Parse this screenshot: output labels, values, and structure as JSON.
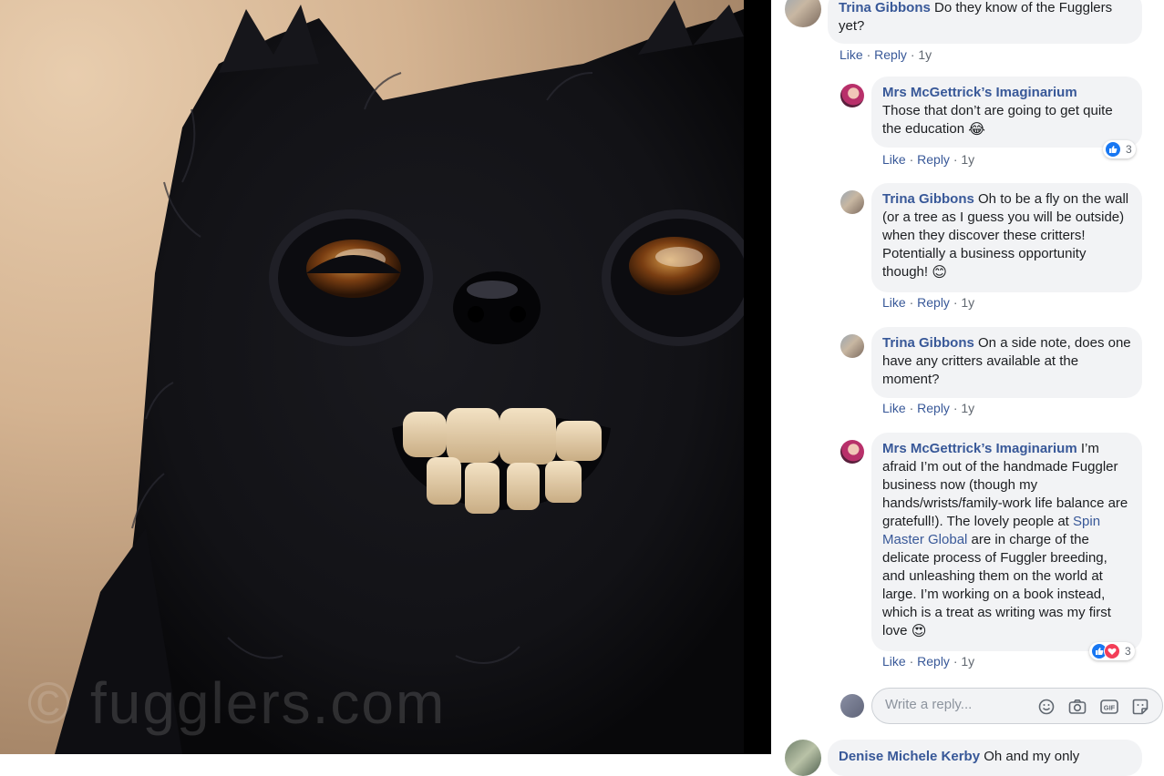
{
  "photo": {
    "watermark_text": "© fugglers.com",
    "description_icon": "fuggler-photo"
  },
  "comments": [
    {
      "author": "Trina Gibbons",
      "text": "Do they know of the Fugglers yet?",
      "actions": {
        "like": "Like",
        "reply": "Reply",
        "time": "1y"
      }
    },
    {
      "author": "Mrs McGettrick’s Imaginarium",
      "text": "Those that don’t are going to get quite the education",
      "emoji": "😂",
      "actions": {
        "like": "Like",
        "reply": "Reply",
        "time": "1y"
      },
      "reactions": {
        "count": "3",
        "types": [
          "like"
        ]
      }
    },
    {
      "author": "Trina Gibbons",
      "text": "Oh to be a fly on the wall (or a tree as I guess you will be outside) when they discover these critters! Potentially a business opportunity though!",
      "emoji": "😊",
      "actions": {
        "like": "Like",
        "reply": "Reply",
        "time": "1y"
      }
    },
    {
      "author": "Trina Gibbons",
      "text": "On a side note, does one have any critters available at the moment?",
      "actions": {
        "like": "Like",
        "reply": "Reply",
        "time": "1y"
      }
    },
    {
      "author": "Mrs McGettrick’s Imaginarium",
      "text_before": "I’m afraid I’m out of the handmade Fuggler business now (though my hands/wrists/family-work life balance are gratefull!). The lovely people at",
      "link": "Spin Master Global",
      "text_after": "are in charge of the delicate process of Fuggler breeding, and unleashing them on the world at large. I’m working on a book instead, which is a treat as writing was my first love",
      "emoji": "😍",
      "actions": {
        "like": "Like",
        "reply": "Reply",
        "time": "1y"
      },
      "reactions": {
        "count": "3",
        "types": [
          "like",
          "love"
        ]
      }
    }
  ],
  "reply_box": {
    "placeholder": "Write a reply...",
    "tools": [
      "emoji-icon",
      "camera-icon",
      "gif-icon",
      "sticker-icon"
    ]
  },
  "next_comment": {
    "author_partial": "Denise Michele Kerby",
    "text_partial": "Oh and my only"
  },
  "colors": {
    "link": "#385898",
    "bubble": "#f2f3f5",
    "meta": "#606770",
    "like": "#1877f2",
    "love": "#f33e58"
  }
}
